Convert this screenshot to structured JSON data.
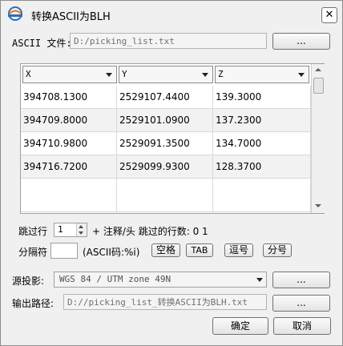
{
  "window": {
    "title": "转换ASCII为BLH",
    "close_glyph": "✕"
  },
  "ascii_file": {
    "label": "ASCII 文件:",
    "value": "D:/picking_list.txt",
    "browse_label": "..."
  },
  "grid": {
    "columns": [
      "X",
      "Y",
      "Z"
    ],
    "rows": [
      [
        "394708.1300",
        "2529107.4400",
        "139.3000"
      ],
      [
        "394709.8000",
        "2529101.0900",
        "137.2300"
      ],
      [
        "394710.9800",
        "2529091.3500",
        "134.7000"
      ],
      [
        "394716.7200",
        "2529099.9300",
        "128.3700"
      ],
      [
        "",
        "",
        ""
      ]
    ]
  },
  "skip": {
    "label": "跳过行",
    "value": "1",
    "comment_label": "+ 注释/头 跳过的行数: 0 1"
  },
  "separator": {
    "label": "分隔符",
    "value": "",
    "ascii_label": "(ASCII码:%i)",
    "space_label": "空格",
    "tab_label": "TAB",
    "comma_label": "逗号",
    "semicolon_label": "分号"
  },
  "source_projection": {
    "label": "源投影:",
    "value": "WGS 84 / UTM zone 49N",
    "browse_label": "..."
  },
  "output_path": {
    "label": "输出路径:",
    "value": "D://picking_list_转换ASCII为BLH.txt",
    "browse_label": "..."
  },
  "footer": {
    "ok_label": "确定",
    "cancel_label": "取消"
  }
}
